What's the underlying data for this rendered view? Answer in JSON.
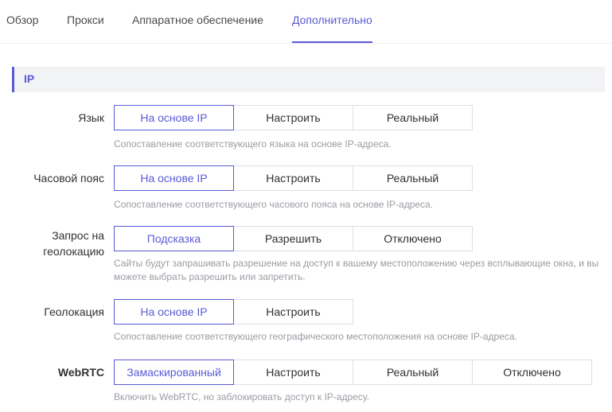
{
  "tabs": [
    {
      "label": "Обзор"
    },
    {
      "label": "Прокси"
    },
    {
      "label": "Аппаратное обеспечение"
    },
    {
      "label": "Дополнительно"
    }
  ],
  "active_tab": "Дополнительно",
  "section": {
    "title": "IP"
  },
  "rows": [
    {
      "label": "Язык",
      "options": [
        "На основе IP",
        "Настроить",
        "Реальный"
      ],
      "selected": "На основе IP",
      "hint": "Сопоставление соответствующего языка на основе IP-адреса."
    },
    {
      "label": "Часовой пояс",
      "options": [
        "На основе IP",
        "Настроить",
        "Реальный"
      ],
      "selected": "На основе IP",
      "hint": "Сопоставление соответствующего часового пояса на основе IP-адреса."
    },
    {
      "label_line1": "Запрос на",
      "label_line2": "геолокацию",
      "options": [
        "Подсказка",
        "Разрешить",
        "Отключено"
      ],
      "selected": "Подсказка",
      "hint_line1": "Сайты будут запрашивать разрешение на доступ к вашему местоположению через всплывающие окна, и вы",
      "hint_line2": "можете выбрать разрешить или запретить."
    },
    {
      "label": "Геолокация",
      "options": [
        "На основе IP",
        "Настроить"
      ],
      "selected": "На основе IP",
      "hint": "Сопоставление соответствующего географического местоположения на основе IP-адреса."
    },
    {
      "label": "WebRTC",
      "options": [
        "Замаскированный",
        "Настроить",
        "Реальный",
        "Отключено"
      ],
      "selected": "Замаскированный",
      "hint": "Включить WebRTC, но заблокировать доступ к IP-адресу."
    }
  ],
  "colors": {
    "accent": "#5b5bd6",
    "border": "#dcdfe6",
    "hint_text": "#9a9ca3",
    "section_bg": "#f2f3f5"
  }
}
